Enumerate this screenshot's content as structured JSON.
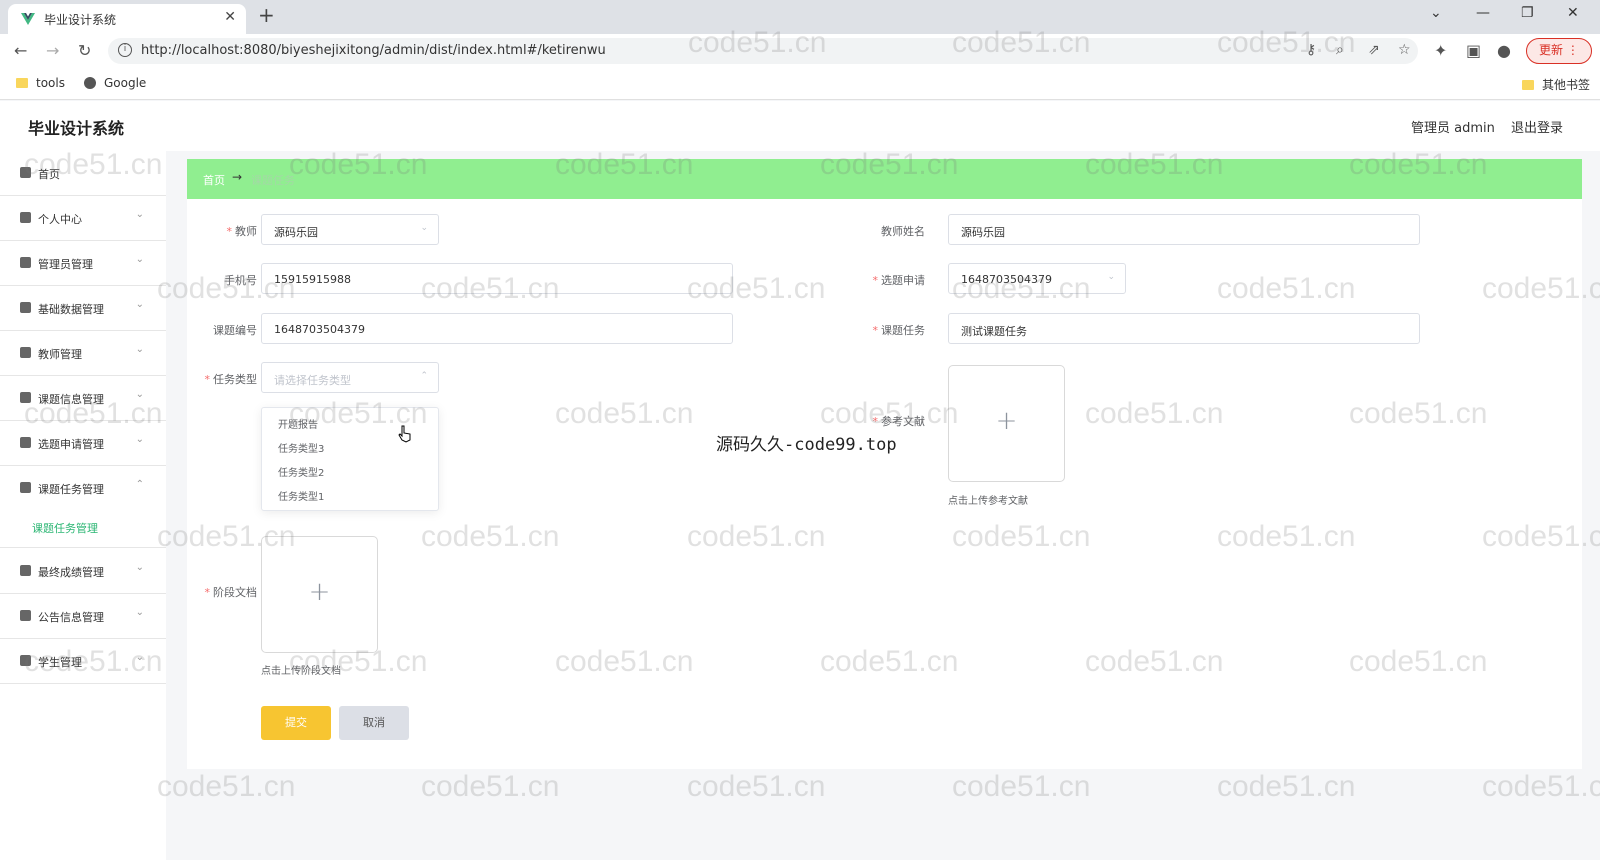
{
  "browser": {
    "tab_title": "毕业设计系统",
    "url": "http://localhost:8080/biyeshejixitong/admin/dist/index.html#/ketirenwu",
    "update_label": "更新",
    "bookmarks": [
      "tools",
      "Google"
    ],
    "other_bookmarks": "其他书签"
  },
  "header": {
    "title": "毕业设计系统",
    "user": "管理员 admin",
    "logout": "退出登录"
  },
  "sidebar": {
    "items": [
      {
        "label": "首页"
      },
      {
        "label": "个人中心"
      },
      {
        "label": "管理员管理"
      },
      {
        "label": "基础数据管理"
      },
      {
        "label": "教师管理"
      },
      {
        "label": "课题信息管理"
      },
      {
        "label": "选题申请管理"
      },
      {
        "label": "课题任务管理"
      },
      {
        "label": "最终成绩管理"
      },
      {
        "label": "公告信息管理"
      },
      {
        "label": "学生管理"
      }
    ],
    "active_sub": "课题任务管理"
  },
  "breadcrumb": {
    "home": "首页",
    "sep": "→",
    "current": "课题任务"
  },
  "form": {
    "teacher_label": "教师",
    "teacher_value": "源码乐园",
    "teacher_name_label": "教师姓名",
    "teacher_name_value": "源码乐园",
    "phone_label": "手机号",
    "phone_value": "15915915988",
    "apply_label": "选题申请",
    "apply_value": "1648703504379",
    "topic_no_label": "课题编号",
    "topic_no_value": "1648703504379",
    "topic_task_label": "课题任务",
    "topic_task_value": "测试课题任务",
    "task_type_label": "任务类型",
    "task_type_placeholder": "请选择任务类型",
    "task_type_options": [
      "开题报告",
      "任务类型3",
      "任务类型2",
      "任务类型1"
    ],
    "ref_doc_label": "参考文献",
    "ref_doc_tip": "点击上传参考文献",
    "stage_doc_label": "阶段文档",
    "stage_doc_tip": "点击上传阶段文档",
    "submit": "提交",
    "cancel": "取消"
  },
  "overlay_text": "源码久久-code99.top",
  "watermark": "code51.cn"
}
